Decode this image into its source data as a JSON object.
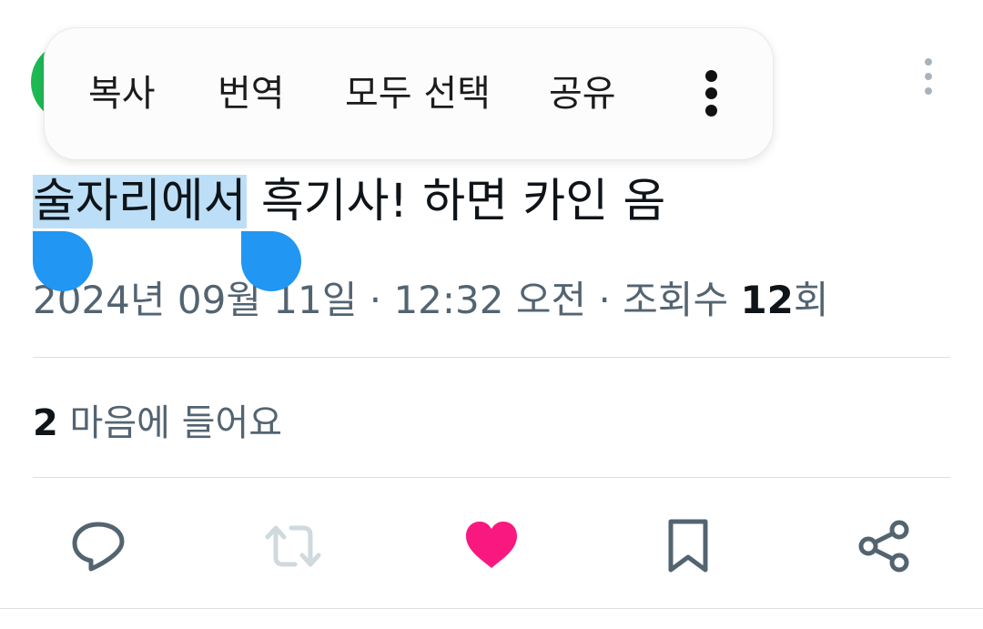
{
  "toolbar": {
    "copy": "복사",
    "translate": "번역",
    "select_all": "모두 선택",
    "share": "공유",
    "overflow_icon": "more-vertical-icon"
  },
  "tweet": {
    "text_selected": "술자리에서",
    "text_rest": " 흑기사! 하면 카인 옴",
    "meta_prefix": "2024년 09월 11일 · 12:32 오전 · 조회수 ",
    "views": "12",
    "views_suffix": "회"
  },
  "likes": {
    "count": "2",
    "label": " 마음에 들어요"
  },
  "actions": {
    "reply_icon": "reply-icon",
    "retweet_icon": "retweet-icon",
    "like_icon": "heart-icon",
    "bookmark_icon": "bookmark-icon",
    "share_icon": "share-icon"
  },
  "colors": {
    "selection": "#bcdff7",
    "handle": "#2196f3",
    "like": "#f91880",
    "muted": "#536471",
    "icon": "#536471",
    "disabled_icon": "#cfd9de"
  }
}
